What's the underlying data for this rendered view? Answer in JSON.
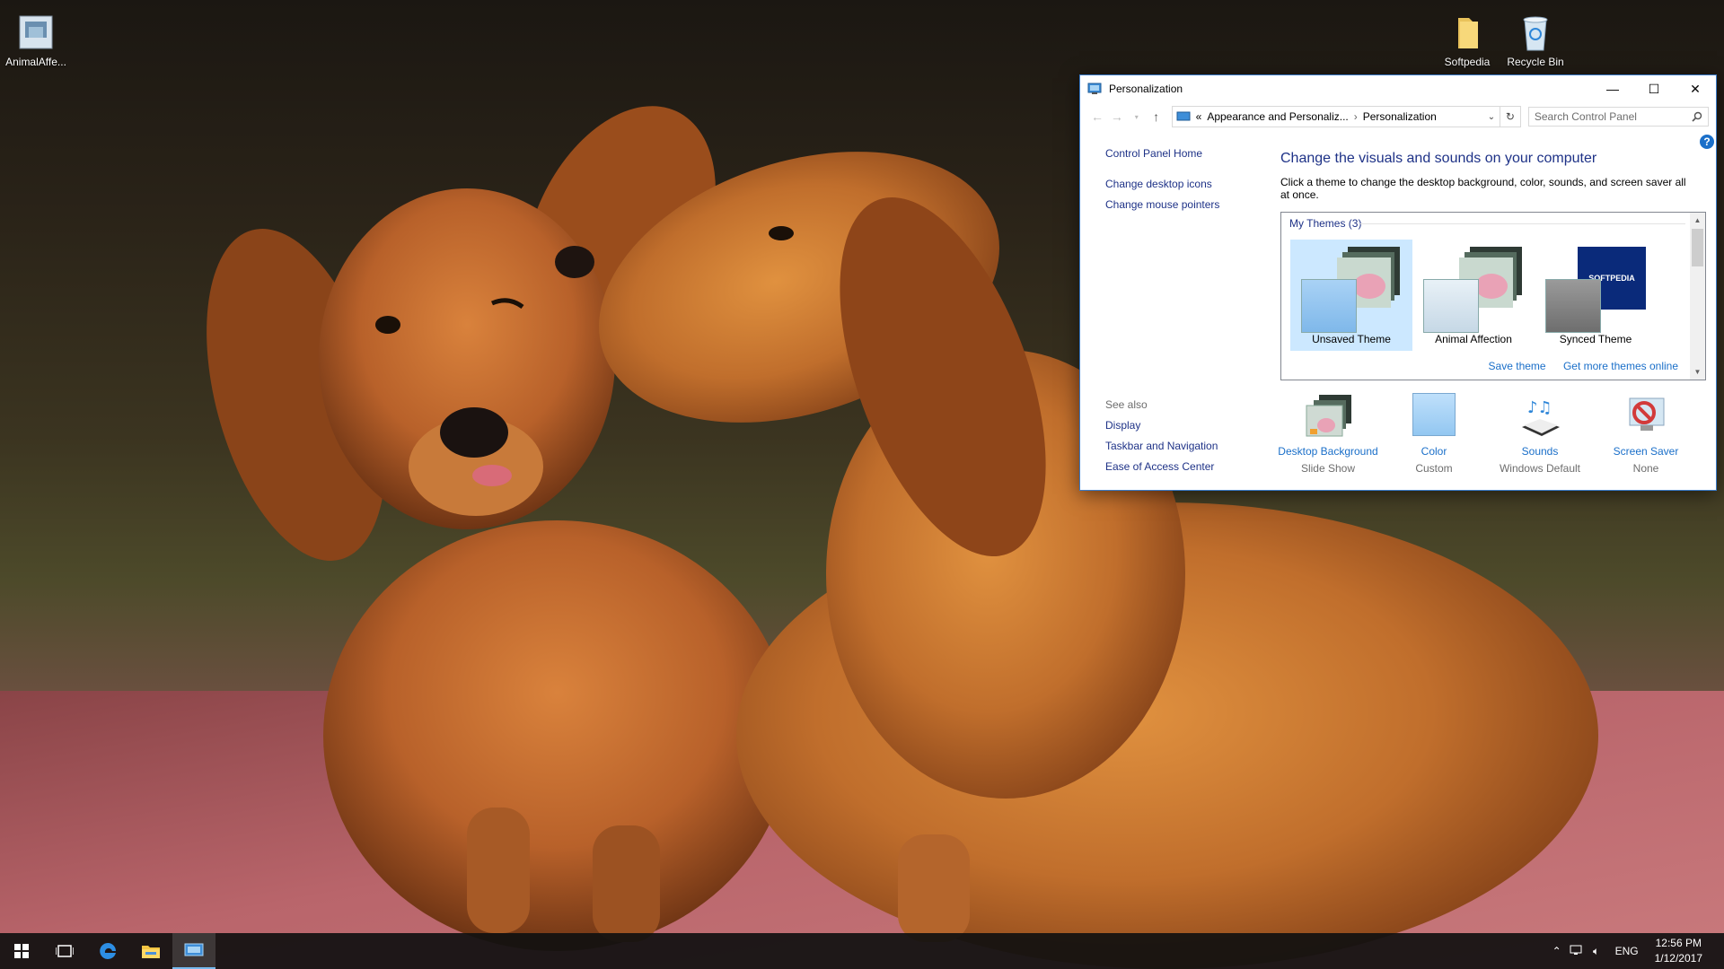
{
  "desktop": {
    "icons": [
      {
        "label": "AnimalAffe..."
      },
      {
        "label": "Softpedia"
      },
      {
        "label": "Recycle Bin"
      }
    ]
  },
  "window": {
    "title": "Personalization",
    "buttons": {
      "minimize": "—",
      "maximize": "☐",
      "close": "✕"
    },
    "breadcrumb": {
      "prefix": "«",
      "parent": "Appearance and Personaliz...",
      "separator": "›",
      "current": "Personalization"
    },
    "search_placeholder": "Search Control Panel",
    "help": "?",
    "left_nav": {
      "home": "Control Panel Home",
      "items": [
        "Change desktop icons",
        "Change mouse pointers"
      ]
    },
    "see_also": {
      "label": "See also",
      "items": [
        "Display",
        "Taskbar and Navigation",
        "Ease of Access Center"
      ]
    },
    "heading": "Change the visuals and sounds on your computer",
    "description": "Click a theme to change the desktop background, color, sounds, and screen saver all at once.",
    "themes": {
      "group_label": "My Themes (3)",
      "items": [
        {
          "name": "Unsaved Theme",
          "selected": true
        },
        {
          "name": "Animal Affection",
          "selected": false
        },
        {
          "name": "Synced Theme",
          "selected": false,
          "thumb_text": "SOFTPEDIA"
        }
      ],
      "save_link": "Save theme",
      "more_link": "Get more themes online"
    },
    "settings": [
      {
        "label": "Desktop Background",
        "value": "Slide Show",
        "icon": "desktop-background-icon"
      },
      {
        "label": "Color",
        "value": "Custom",
        "icon": "color-swatch-icon"
      },
      {
        "label": "Sounds",
        "value": "Windows Default",
        "icon": "sounds-icon"
      },
      {
        "label": "Screen Saver",
        "value": "None",
        "icon": "screen-saver-icon"
      }
    ]
  },
  "taskbar": {
    "tray": {
      "language": "ENG",
      "time": "12:56 PM",
      "date": "1/12/2017"
    }
  },
  "colors": {
    "link": "#1a6fc9",
    "nav_link": "#1e3287",
    "selected_theme": "#cce8ff",
    "accent": "#76b9ed"
  }
}
